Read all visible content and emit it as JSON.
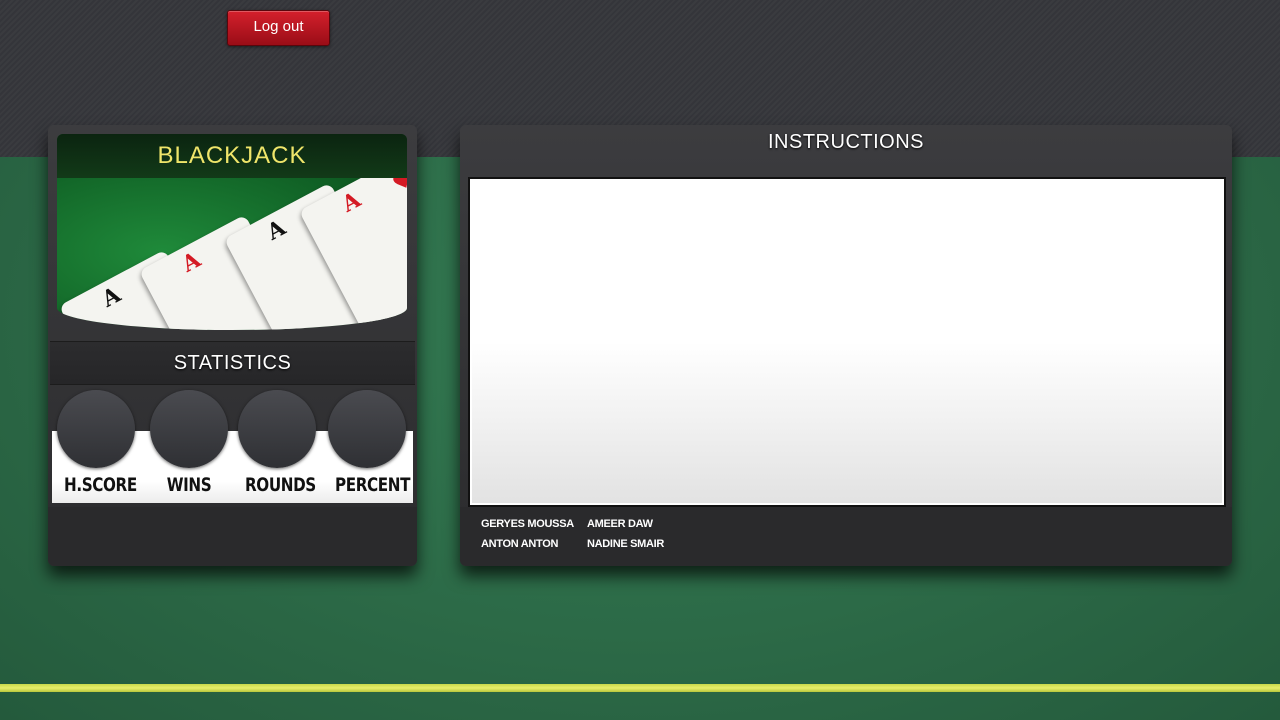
{
  "header": {
    "logout_label": "Log out"
  },
  "game_panel": {
    "title": "BLACKJACK",
    "cards": [
      "A",
      "A",
      "A",
      "A"
    ]
  },
  "statistics": {
    "title": "STATISTICS",
    "items": [
      {
        "label": "H.SCORE"
      },
      {
        "label": "WINS"
      },
      {
        "label": "ROUNDS"
      },
      {
        "label": "PERCENT"
      }
    ]
  },
  "instructions": {
    "title": "INSTRUCTIONS",
    "body": ""
  },
  "credits": [
    "GERYES MOUSSA",
    "AMEER DAW",
    "ANTON ANTON",
    "NADINE SMAIR"
  ],
  "colors": {
    "logout": "#c0121f",
    "title": "#efe56a",
    "felt": "#2f6b48",
    "felt_line": "#e0e865"
  }
}
